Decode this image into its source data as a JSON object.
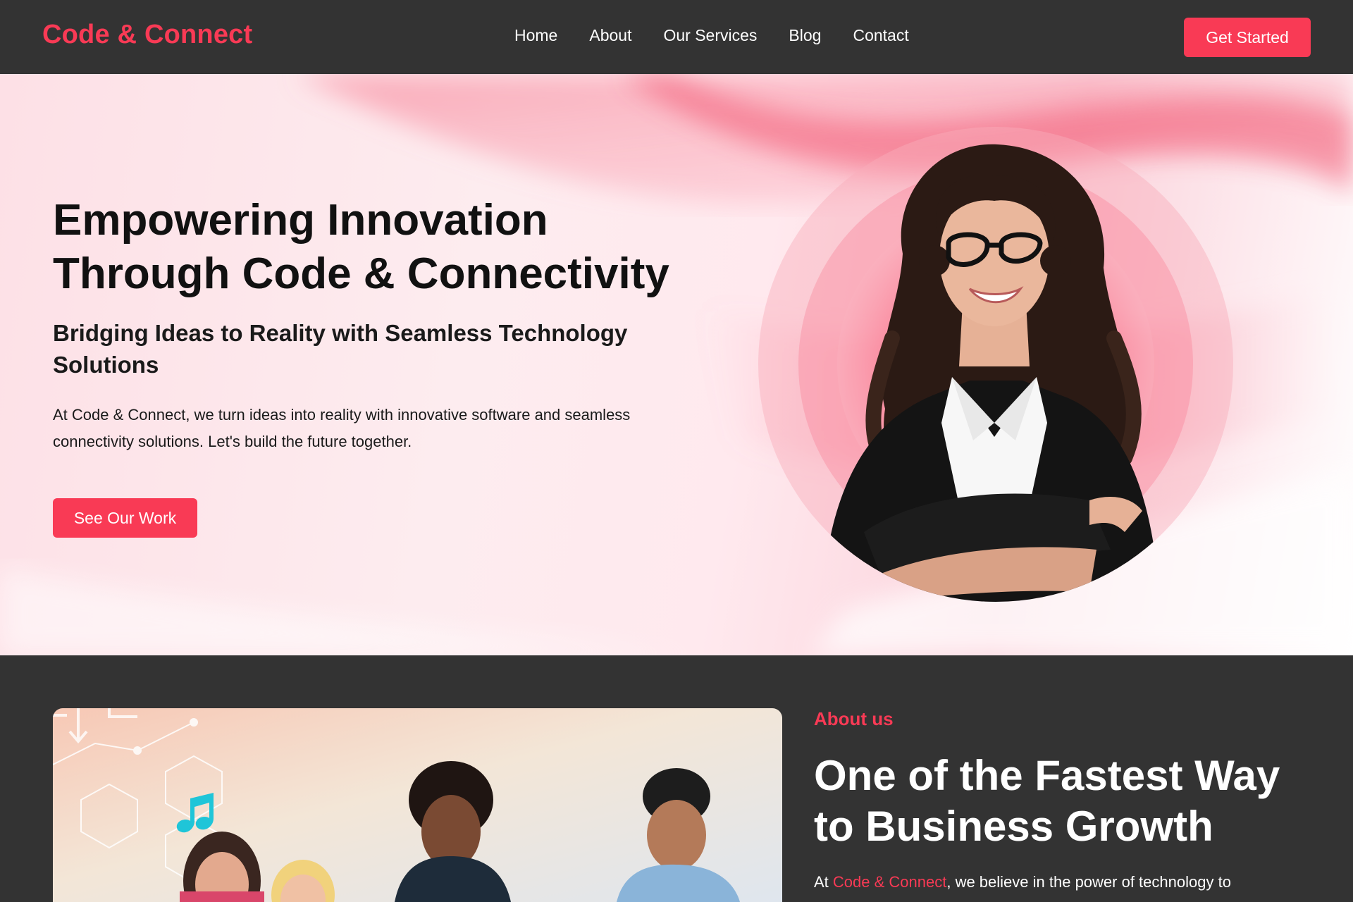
{
  "nav": {
    "brand": "Code & Connect",
    "links": [
      "Home",
      "About",
      "Our Services",
      "Blog",
      "Contact"
    ],
    "cta": "Get Started"
  },
  "hero": {
    "title_line1": "Empowering Innovation",
    "title_line2": "Through Code & Connectivity",
    "subtitle": "Bridging Ideas to Reality with Seamless Technology Solutions",
    "text": "At Code & Connect, we turn ideas into reality with innovative software and seamless connectivity solutions. Let's build the future together.",
    "button": "See Our Work"
  },
  "about": {
    "kicker": "About us",
    "title_line1": "One of the Fastest Way",
    "title_line2": "to Business Growth",
    "text_prefix": "At ",
    "text_highlight": "Code & Connect",
    "text_suffix": ", we believe in the power of technology to"
  },
  "colors": {
    "accent": "#f93a55",
    "nav_bg": "#333333",
    "hero_pink": "#fde0e6"
  },
  "icons": {
    "music_note": "music-note-icon",
    "down_arrow": "down-arrow-icon"
  }
}
